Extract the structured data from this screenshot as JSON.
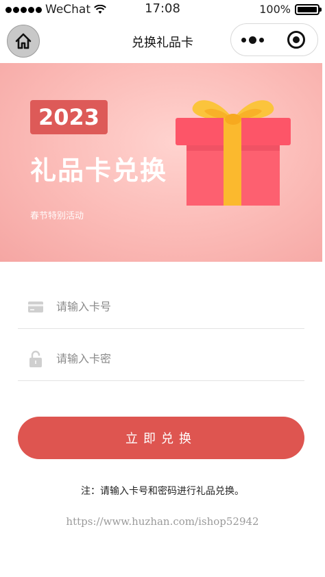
{
  "status_bar": {
    "carrier": "WeChat",
    "time": "17:08",
    "battery_text": "100%",
    "battery_level": 1.0
  },
  "nav": {
    "title": "兑换礼品卡",
    "home_icon": "home-icon",
    "more_icon": "more-dots-icon",
    "close_icon": "close-target-icon"
  },
  "banner": {
    "year": "2023",
    "title": "礼品卡兑换",
    "subtitle": "春节特别活动",
    "colors": {
      "badge": "#dd5a58",
      "gift_box": "#fd5f6d",
      "ribbon": "#fbb92e"
    }
  },
  "form": {
    "card_number_placeholder": "请输入卡号",
    "card_number_value": "",
    "card_password_placeholder": "请输入卡密",
    "card_password_value": "",
    "card_icon": "card-icon",
    "lock_icon": "lock-icon"
  },
  "submit": {
    "label": "立即兑换",
    "color": "#de5550"
  },
  "note": "注：请输入卡号和密码进行礼品兑换。",
  "watermark": "https://www.huzhan.com/ishop52942"
}
